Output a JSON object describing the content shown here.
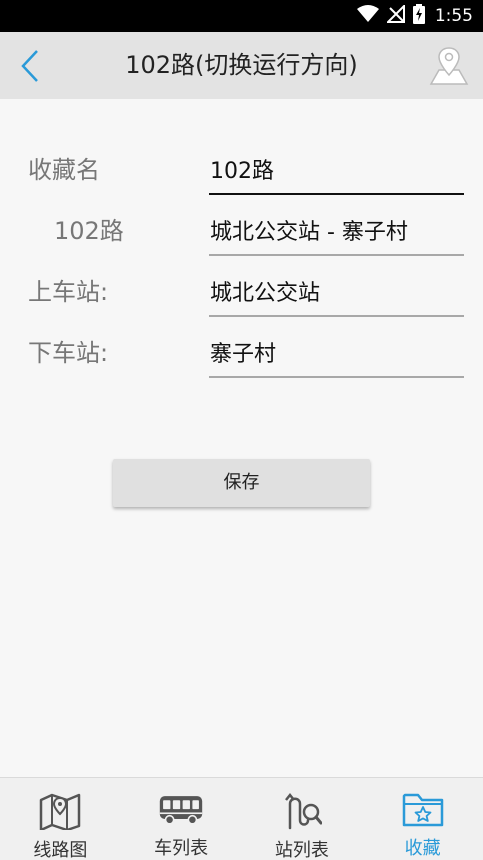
{
  "status_bar": {
    "time": "1:55"
  },
  "app_bar": {
    "title": "102路(切换运行方向)"
  },
  "form": {
    "favorite_name": {
      "label": "收藏名",
      "value": "102路"
    },
    "route": {
      "label": "102路",
      "value": "城北公交站 - 寨子村"
    },
    "boarding_stop": {
      "label": "上车站:",
      "value": "城北公交站"
    },
    "alighting_stop": {
      "label": "下车站:",
      "value": "寨子村"
    }
  },
  "save_label": "保存",
  "nav": {
    "items": [
      {
        "label": "线路图",
        "icon": "map-icon",
        "active": false
      },
      {
        "label": "车列表",
        "icon": "bus-icon",
        "active": false
      },
      {
        "label": "站列表",
        "icon": "stop-list-icon",
        "active": false
      },
      {
        "label": "收藏",
        "icon": "favorite-folder-icon",
        "active": true
      }
    ]
  },
  "colors": {
    "accent": "#2a9ad8",
    "app_bar": "#e3e3e3",
    "background": "#f7f7f7"
  }
}
